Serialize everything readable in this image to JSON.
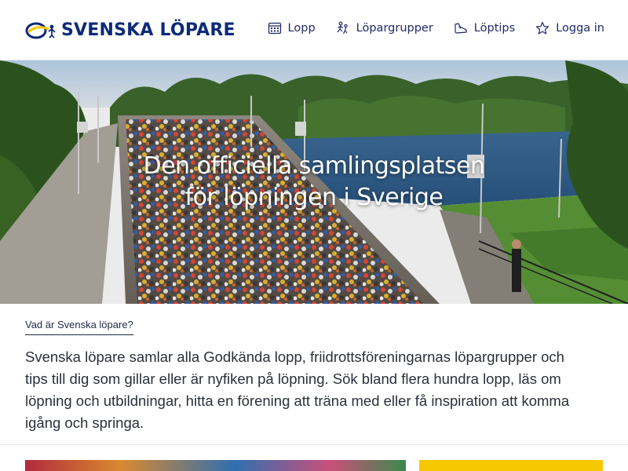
{
  "header": {
    "logo_text": "SVENSKA LÖPARE",
    "logo_icon": "runner-swoosh-logo",
    "nav": [
      {
        "label": "Lopp",
        "icon": "calendar-icon"
      },
      {
        "label": "Löpargrupper",
        "icon": "group-runners-icon"
      },
      {
        "label": "Löptips",
        "icon": "shoe-icon"
      },
      {
        "label": "Logga in",
        "icon": "star-icon"
      }
    ]
  },
  "hero": {
    "title_line1": "Den officiella samlingsplatsen",
    "title_line2": "för löpningen i Sverige"
  },
  "intro": {
    "link": "Vad är Svenska löpare?",
    "text": "Svenska löpare samlar alla Godkända lopp, friidrottsföreningarnas löpargrupper och tips till dig som gillar eller är nyfiken på löpning. Sök bland flera hundra lopp, läs om löpning och utbildningar, hitta en förening att träna med eller få inspiration att komma igång och springa."
  },
  "colors": {
    "brand_blue": "#0d2a7a",
    "brand_yellow": "#f6c800",
    "text": "#2b2f3a"
  }
}
